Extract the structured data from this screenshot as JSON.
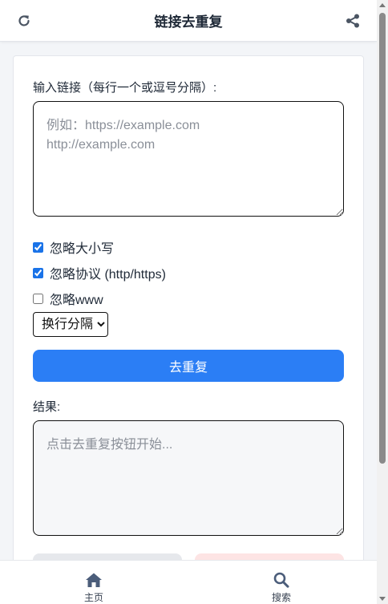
{
  "header": {
    "title": "链接去重复",
    "refresh_icon": "refresh-icon",
    "share_icon": "share-icon"
  },
  "form": {
    "input_label": "输入链接（每行一个或逗号分隔）:",
    "input_placeholder": "例如：https://example.com\nhttp://example.com",
    "options": [
      {
        "label": "忽略大小写",
        "checked": true
      },
      {
        "label": "忽略协议 (http/https)",
        "checked": true
      },
      {
        "label": "忽略www",
        "checked": false
      }
    ],
    "separator_select": {
      "selected": "换行分隔",
      "options": [
        "换行分隔"
      ]
    },
    "dedupe_button": "去重复",
    "result_label": "结果:",
    "result_placeholder": "点击去重复按钮开始..."
  },
  "bottom_nav": {
    "items": [
      {
        "label": "主页",
        "icon": "home-icon"
      },
      {
        "label": "搜索",
        "icon": "search-icon"
      }
    ]
  },
  "colors": {
    "primary": "#2b7ef5",
    "checkbox": "#1a73e8",
    "secondary_button": "#e6e8ec",
    "danger_button": "#fde4e4"
  }
}
